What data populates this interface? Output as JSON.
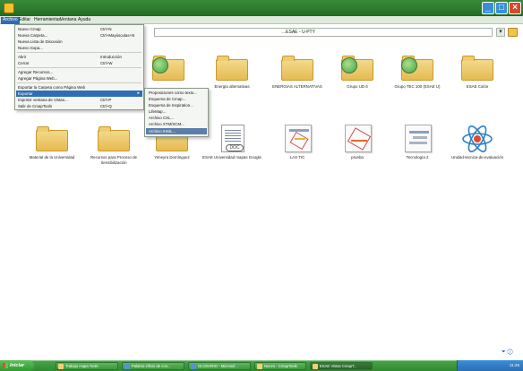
{
  "menubar": {
    "items": [
      "Archivo",
      "Editar",
      "Herramientas",
      "Ventana",
      "Ayuda"
    ]
  },
  "address": {
    "value": "...ESAE - U-PTY"
  },
  "dropdown": {
    "items": [
      {
        "label": "Nuevo Cmap",
        "shortcut": "Ctrl+N"
      },
      {
        "label": "Nueva Carpeta...",
        "shortcut": "Ctrl+Mayúsculas+N"
      },
      {
        "label": "Nueva Lista de Discusión",
        "shortcut": ""
      },
      {
        "label": "Nuevo Sopa...",
        "shortcut": ""
      },
      {
        "label": "Abrir",
        "shortcut": "Introducción"
      },
      {
        "label": "Cerrar",
        "shortcut": "Ctrl+W"
      },
      {
        "label": "Agregar Recursos...",
        "shortcut": ""
      },
      {
        "label": "Agregar Página Web...",
        "shortcut": ""
      },
      {
        "label": "Exportar la Carpeta como Página Web",
        "shortcut": ""
      },
      {
        "label": "Exportar",
        "shortcut": ""
      },
      {
        "label": "Imprimir ventana de Vistas...",
        "shortcut": "Ctrl+P"
      },
      {
        "label": "Salir de CmapTools",
        "shortcut": "Ctrl+Q"
      }
    ]
  },
  "submenu": {
    "items": [
      "Proposiciones como texto...",
      "Esquema de Cmap...",
      "Esquema de Inspiration...",
      "LifeMap...",
      "Archivo CXL...",
      "Archivo XTM/XCM...",
      "Archivo IHML..."
    ]
  },
  "grid": {
    "row1": [
      {
        "label": "Energía alternativas",
        "type": "folder"
      },
      {
        "label": "ENERGIAS ALTERNATIVAS",
        "type": "folder"
      },
      {
        "label": "Grupo UD 6",
        "type": "cmap-folder"
      },
      {
        "label": "Grupo TEC 100 (ESAE U)",
        "type": "cmap-folder"
      },
      {
        "label": "ESAE Colón",
        "type": "folder"
      }
    ],
    "row2": [
      {
        "label": "Material de la Universidad",
        "type": "folder"
      },
      {
        "label": "Recursos para Proceso de Sensibilización",
        "type": "folder"
      },
      {
        "label": "Yeneyra Domínguez",
        "type": "folder"
      },
      {
        "label": "ESAE Universidad mapas Google",
        "type": "doc"
      },
      {
        "label": "LAS TIC",
        "type": "cmap"
      },
      {
        "label": "prueba",
        "type": "cmap"
      },
      {
        "label": "Tecnología 2",
        "type": "cmap"
      },
      {
        "label": "Unidad-tecnica-de-evaluación",
        "type": "atom"
      }
    ],
    "doc_tag": "DOC"
  },
  "taskbar": {
    "start_label": "Iniciar",
    "tasks": [
      "Trabajo mapa Tools",
      "Palabra Oficio de con...",
      "GLOSARIO - Microsof...",
      "Nuevo - CmapTools",
      "ESAE Vistas CmapT..."
    ],
    "clock": "11:25"
  },
  "colors": {
    "accent": "#2f6db5",
    "taskbar": "#3f963f",
    "folder": "#e6bb52"
  }
}
